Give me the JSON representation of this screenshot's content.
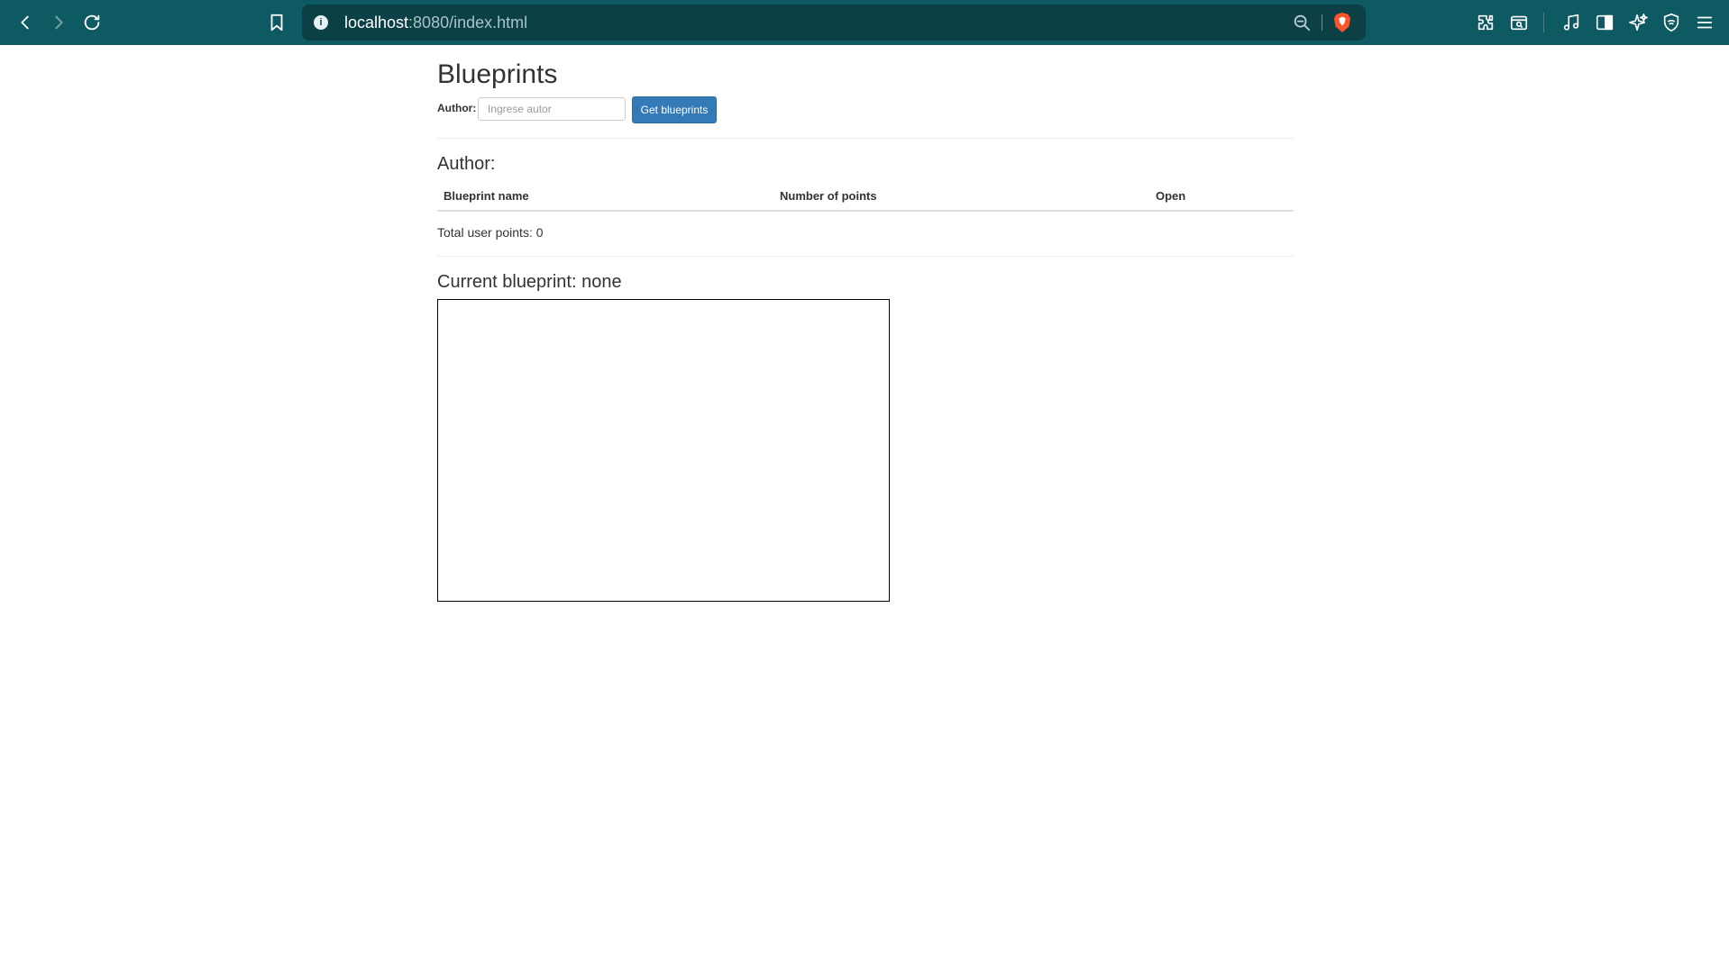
{
  "browser": {
    "url_host": "localhost",
    "url_path": ":8080/index.html",
    "icons": [
      "back-icon",
      "forward-icon",
      "reload-icon",
      "bookmark-icon",
      "site-info-icon",
      "zoom-icon",
      "brave-shield-icon",
      "extensions-icon",
      "screenshot-icon",
      "media-icon",
      "sidebar-icon",
      "leo-ai-icon",
      "vpn-icon",
      "menu-icon"
    ],
    "accent_color": "#0e5a62"
  },
  "page": {
    "title": "Blueprints",
    "author_label": "Author:",
    "author_input_placeholder": "Ingrese autor",
    "author_input_value": "",
    "get_button_label": "Get blueprints",
    "author_heading": "Author:",
    "table": {
      "columns": [
        "Blueprint name",
        "Number of points",
        "Open"
      ],
      "rows": []
    },
    "total_points": "Total user points: 0",
    "current_blueprint": "Current blueprint: none",
    "button_color": "#337ab7"
  }
}
